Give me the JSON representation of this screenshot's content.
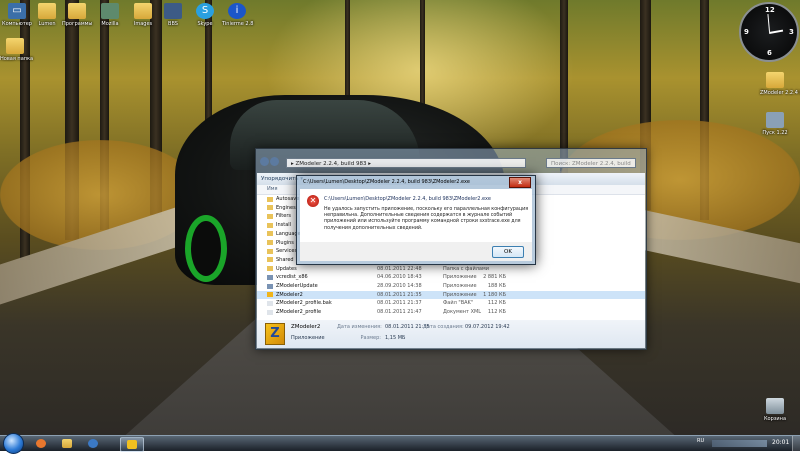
{
  "desktop": {
    "icons": [
      {
        "label": "Компьютер",
        "icon": "computer-icon"
      },
      {
        "label": "Lumen",
        "icon": "folder-icon"
      },
      {
        "label": "Программы",
        "icon": "folder-icon"
      },
      {
        "label": "Mozilla",
        "icon": "image-icon"
      },
      {
        "label": "Images",
        "icon": "folder-icon"
      },
      {
        "label": "BBS",
        "icon": "screen-icon"
      },
      {
        "label": "Skype",
        "icon": "skype-icon"
      },
      {
        "label": "Tinierme 2.8",
        "icon": "info-icon"
      },
      {
        "label": "Новая папка",
        "icon": "folder-icon"
      },
      {
        "label": "ZModeler 2.2.4 bui",
        "icon": "folder-icon"
      },
      {
        "label": "Пуск 1.22",
        "icon": "app-icon"
      },
      {
        "label": "Корзина",
        "icon": "recycle-bin-icon"
      }
    ],
    "clock_gadget": {
      "numbers": [
        "12",
        "3",
        "6",
        "9"
      ]
    }
  },
  "explorer": {
    "address": "▸ ZModeler 2.2.4, build 983 ▸",
    "search_placeholder": "Поиск: ZModeler 2.2.4, build 983",
    "toolbar_label": "Упорядочить ▾",
    "column_header": "Имя",
    "files": [
      {
        "name": "Autosave",
        "date": "",
        "type": "",
        "size": "",
        "kind": "folder"
      },
      {
        "name": "Engines",
        "date": "",
        "type": "",
        "size": "",
        "kind": "folder"
      },
      {
        "name": "Filters",
        "date": "",
        "type": "",
        "size": "",
        "kind": "folder"
      },
      {
        "name": "Install",
        "date": "",
        "type": "",
        "size": "",
        "kind": "folder"
      },
      {
        "name": "Languages",
        "date": "",
        "type": "",
        "size": "",
        "kind": "folder"
      },
      {
        "name": "Plugins",
        "date": "",
        "type": "",
        "size": "",
        "kind": "folder"
      },
      {
        "name": "Services",
        "date": "",
        "type": "",
        "size": "",
        "kind": "folder"
      },
      {
        "name": "Shared",
        "date": "",
        "type": "",
        "size": "",
        "kind": "folder"
      },
      {
        "name": "Updates",
        "date": "08.01.2011 22:48",
        "type": "Папка с файлами",
        "size": "",
        "kind": "folder"
      },
      {
        "name": "vcredist_x86",
        "date": "04.06.2010 18:43",
        "type": "Приложение",
        "size": "2 881 КБ",
        "kind": "exe"
      },
      {
        "name": "ZModelerUpdate",
        "date": "28.09.2010 14:38",
        "type": "Приложение",
        "size": "188 КБ",
        "kind": "exe"
      },
      {
        "name": "ZModeler2",
        "date": "08.01.2011 21:35",
        "type": "Приложение",
        "size": "1 180 КБ",
        "kind": "z",
        "selected": true
      },
      {
        "name": "ZModeler2_profile.bak",
        "date": "08.01.2011 21:37",
        "type": "Файл \"BAK\"",
        "size": "112 КБ",
        "kind": "file"
      },
      {
        "name": "ZModeler2_profile",
        "date": "08.01.2011 21:47",
        "type": "Документ XML",
        "size": "112 КБ",
        "kind": "file"
      }
    ],
    "details": {
      "name": "ZModeler2",
      "kind": "Приложение",
      "modified_label": "Дата изменения:",
      "modified_value": "08.01.2011 21:35",
      "size_label": "Размер:",
      "size_value": "1,15 МБ",
      "created_label": "Дата создания:",
      "created_value": "09.07.2012 19:42"
    }
  },
  "dialog": {
    "title": "C:\\Users\\Lumen\\Desktop\\ZModeler 2.2.4, build 983\\ZModeler2.exe",
    "path": "C:\\Users\\Lumen\\Desktop\\ZModeler 2.2.4, build 983\\ZModeler2.exe",
    "message": "Не удалось запустить приложение, поскольку его параллельная конфигурация неправильна. Дополнительные сведения содержатся в журнале событий приложений или используйте программу командной строки sxstrace.exe для получения дополнительных сведений.",
    "ok_label": "OK",
    "close_label": "x"
  },
  "taskbar": {
    "lang": "RU",
    "time": "20:01"
  },
  "colors": {
    "accent": "#2c7ad6",
    "error": "#c22b12",
    "selection": "#cde3f8"
  }
}
